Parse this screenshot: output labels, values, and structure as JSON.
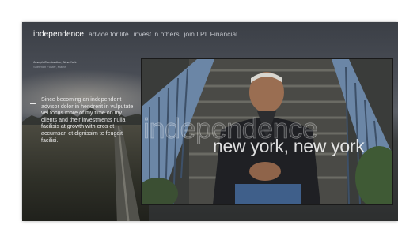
{
  "nav": {
    "brand": "independence",
    "links": [
      "advice for life",
      "invest in others",
      "join LPL Financial"
    ]
  },
  "meta": {
    "lines": [
      "",
      "",
      "",
      "Joseph Constantine, New York",
      "Sherman Foster, Maine"
    ]
  },
  "quote": {
    "text": "Since becoming an independent advisor dolor in hendrerit in vulputate vel focus more of my time on my clients and their investments nulla facilisis at growth with eros et accumsan et dignissim te feugait facilisi."
  },
  "hero": {
    "title": "independence",
    "location": "new york, new york"
  },
  "colors": {
    "page_bg": "#ffffff",
    "banner_bg": "#3b3f46",
    "nav_link": "#bfc2c8",
    "brand": "#ffffff"
  }
}
